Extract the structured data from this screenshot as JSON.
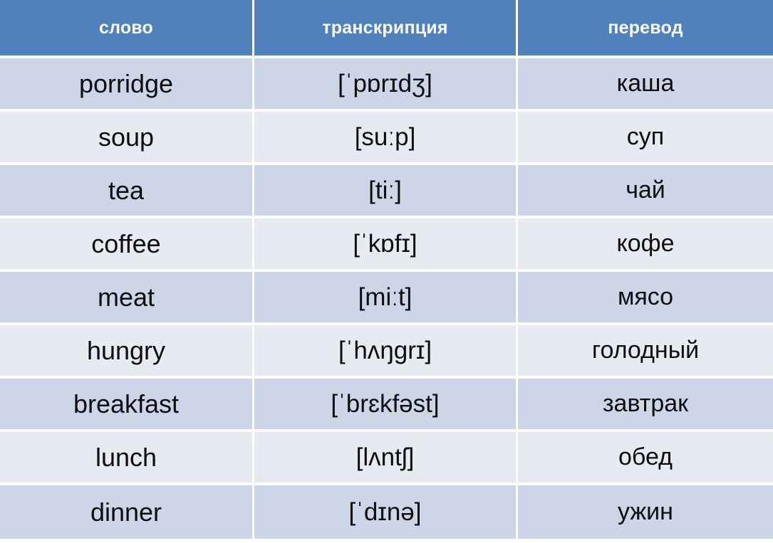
{
  "table": {
    "columns": [
      {
        "key": "word",
        "label": "слово"
      },
      {
        "key": "transcription",
        "label": "транскрипция"
      },
      {
        "key": "translation",
        "label": "перевод"
      }
    ],
    "rows": [
      {
        "word": "porridge",
        "transcription": "[ˈpɒrɪdʒ]",
        "translation": "каша"
      },
      {
        "word": "soup",
        "transcription": "[suːp]",
        "translation": "суп"
      },
      {
        "word": "tea",
        "transcription": "[tiː]",
        "translation": "чай"
      },
      {
        "word": "coffee",
        "transcription": "[ˈkɒfɪ]",
        "translation": "кофе"
      },
      {
        "word": "meat",
        "transcription": "[miːt]",
        "translation": "мясо"
      },
      {
        "word": "hungry",
        "transcription": "[ˈhʌŋgrɪ]",
        "translation": "голодный"
      },
      {
        "word": "breakfast",
        "transcription": "[ˈbrɛkfəst]",
        "translation": "завтрак"
      },
      {
        "word": "lunch",
        "transcription": "[lʌntʃ]",
        "translation": "обед"
      },
      {
        "word": "dinner",
        "transcription": "[ˈdɪnə]",
        "translation": "ужин"
      }
    ]
  },
  "colors": {
    "header_background": "#4F81BD",
    "header_text": "#FFFFFF",
    "row_odd_background": "#CCD6E7",
    "row_even_background": "#E7EBF1",
    "grid_line": "#FFFFFF",
    "body_text": "#0D0D0D"
  }
}
